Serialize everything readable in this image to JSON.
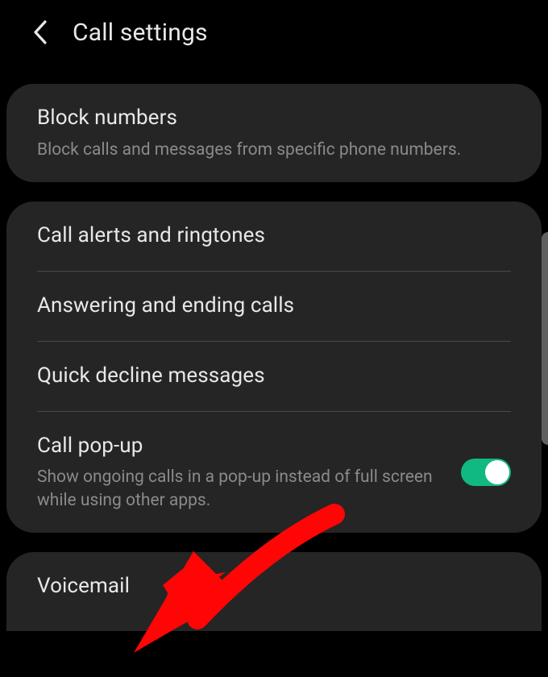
{
  "header": {
    "title": "Call settings"
  },
  "sections": {
    "block": {
      "title": "Block numbers",
      "subtitle": "Block calls and messages from specific phone numbers."
    },
    "alerts": {
      "title": "Call alerts and ringtones"
    },
    "answering": {
      "title": "Answering and ending calls"
    },
    "decline": {
      "title": "Quick decline messages"
    },
    "popup": {
      "title": "Call pop-up",
      "subtitle": "Show ongoing calls in a pop-up instead of full screen while using other apps.",
      "toggle_on": true
    },
    "voicemail": {
      "title": "Voicemail"
    }
  },
  "annotation": {
    "arrow_color": "#ff0000"
  }
}
